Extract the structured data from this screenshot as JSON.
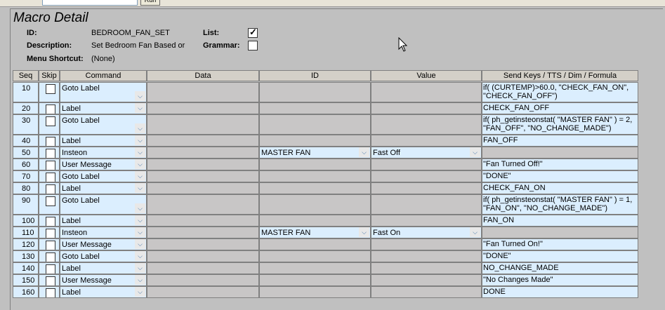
{
  "page_title": "Macro Detail",
  "fields": {
    "id_label": "ID:",
    "id_value": "BEDROOM_FAN_SET",
    "description_label": "Description:",
    "description_value": "Set Bedroom Fan Based or",
    "menu_shortcut_label": "Menu Shortcut:",
    "menu_shortcut_value": "(None)",
    "list_label": "List:",
    "list_checked": true,
    "grammar_label": "Grammar:",
    "grammar_checked": false
  },
  "top_button": "Run",
  "columns": [
    "Seq",
    "Skip",
    "Command",
    "Data",
    "ID",
    "Value",
    "Send Keys / TTS / Dim / Formula"
  ],
  "rows": [
    {
      "seq": "10",
      "command": "Goto Label",
      "id": "",
      "value": "",
      "send": "if( (CURTEMP)>60.0, \"CHECK_FAN_ON\",\n\"CHECK_FAN_OFF\")",
      "tall": true
    },
    {
      "seq": "20",
      "command": "Label",
      "id": "",
      "value": "",
      "send": "CHECK_FAN_OFF",
      "tall": false
    },
    {
      "seq": "30",
      "command": "Goto Label",
      "id": "",
      "value": "",
      "send": "if( ph_getinsteonstat( \"MASTER FAN\" ) = 2,\n\"FAN_OFF\", \"NO_CHANGE_MADE\")",
      "tall": true
    },
    {
      "seq": "40",
      "command": "Label",
      "id": "",
      "value": "",
      "send": "FAN_OFF",
      "tall": false
    },
    {
      "seq": "50",
      "command": "Insteon",
      "id": "MASTER FAN",
      "value": "Fast Off",
      "send": "",
      "tall": false
    },
    {
      "seq": "60",
      "command": "User Message",
      "id": "",
      "value": "",
      "send": "\"Fan Turned Off!\"",
      "tall": false
    },
    {
      "seq": "70",
      "command": "Goto Label",
      "id": "",
      "value": "",
      "send": "\"DONE\"",
      "tall": false
    },
    {
      "seq": "80",
      "command": "Label",
      "id": "",
      "value": "",
      "send": "CHECK_FAN_ON",
      "tall": false
    },
    {
      "seq": "90",
      "command": "Goto Label",
      "id": "",
      "value": "",
      "send": "if( ph_getinsteonstat( \"MASTER FAN\" ) = 1,\n\"FAN_ON\", \"NO_CHANGE_MADE\")",
      "tall": true
    },
    {
      "seq": "100",
      "command": "Label",
      "id": "",
      "value": "",
      "send": "FAN_ON",
      "tall": false
    },
    {
      "seq": "110",
      "command": "Insteon",
      "id": "MASTER FAN",
      "value": "Fast On",
      "send": "",
      "tall": false
    },
    {
      "seq": "120",
      "command": "User Message",
      "id": "",
      "value": "",
      "send": "\"Fan Turned On!\"",
      "tall": false
    },
    {
      "seq": "130",
      "command": "Goto Label",
      "id": "",
      "value": "",
      "send": "\"DONE\"",
      "tall": false
    },
    {
      "seq": "140",
      "command": "Label",
      "id": "",
      "value": "",
      "send": "NO_CHANGE_MADE",
      "tall": false
    },
    {
      "seq": "150",
      "command": "User Message",
      "id": "",
      "value": "",
      "send": "\"No Changes Made\"",
      "tall": false
    },
    {
      "seq": "160",
      "command": "Label",
      "id": "",
      "value": "",
      "send": "DONE",
      "tall": false
    }
  ],
  "icons": {
    "dropdown": "chevron-down-icon",
    "cursor": "mouse-pointer-icon"
  }
}
